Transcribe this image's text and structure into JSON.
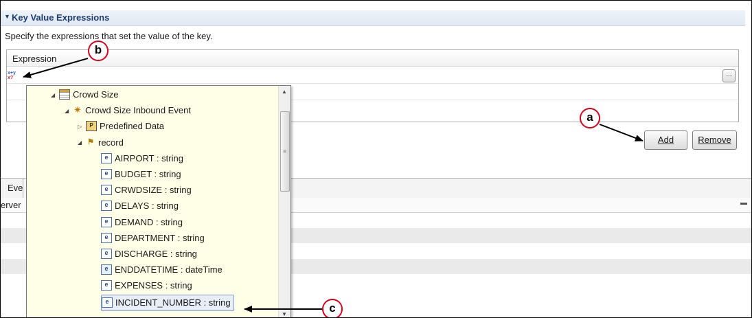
{
  "section": {
    "title": "Key Value Expressions",
    "description": "Specify the expressions that set the value of the key."
  },
  "expression_table": {
    "column_header": "Expression",
    "row_icon": "expression-icon",
    "ellipsis_label": "...",
    "icon_text_top": "x+y",
    "icon_text_bottom": "x?"
  },
  "buttons": {
    "add": "Add",
    "remove": "Remove"
  },
  "lower_panel": {
    "tab_fragment": "Eve",
    "view_fragment": "erver"
  },
  "content_assist": {
    "items": [
      {
        "label": "Crowd Size",
        "icon": "table-icon",
        "twisty": "expanded",
        "level": 0
      },
      {
        "label": "Crowd Size Inbound Event",
        "icon": "event-icon",
        "twisty": "expanded",
        "level": 1
      },
      {
        "label": "Predefined Data",
        "icon": "predefined-data-icon",
        "twisty": "collapsed",
        "level": 2
      },
      {
        "label": "record",
        "icon": "record-icon",
        "twisty": "expanded",
        "level": 2
      },
      {
        "label": "AIRPORT : string",
        "icon": "string-field-icon",
        "level": 3
      },
      {
        "label": "BUDGET : string",
        "icon": "string-field-icon",
        "level": 3
      },
      {
        "label": "CRWDSIZE : string",
        "icon": "string-field-icon",
        "level": 3
      },
      {
        "label": "DELAYS : string",
        "icon": "string-field-icon",
        "level": 3
      },
      {
        "label": "DEMAND : string",
        "icon": "string-field-icon",
        "level": 3
      },
      {
        "label": "DEPARTMENT : string",
        "icon": "string-field-icon",
        "level": 3
      },
      {
        "label": "DISCHARGE : string",
        "icon": "string-field-icon",
        "level": 3
      },
      {
        "label": "ENDDATETIME : dateTime",
        "icon": "datetime-field-icon",
        "level": 3
      },
      {
        "label": "EXPENSES : string",
        "icon": "string-field-icon",
        "level": 3
      },
      {
        "label": "INCIDENT_NUMBER : string",
        "icon": "string-field-icon",
        "level": 3,
        "selected": true
      }
    ]
  },
  "callouts": {
    "a": "a",
    "b": "b",
    "c": "c"
  },
  "colors": {
    "callout_border": "#d4001c",
    "header_text": "#1f3d70",
    "popup_bg": "#ffffe7"
  }
}
